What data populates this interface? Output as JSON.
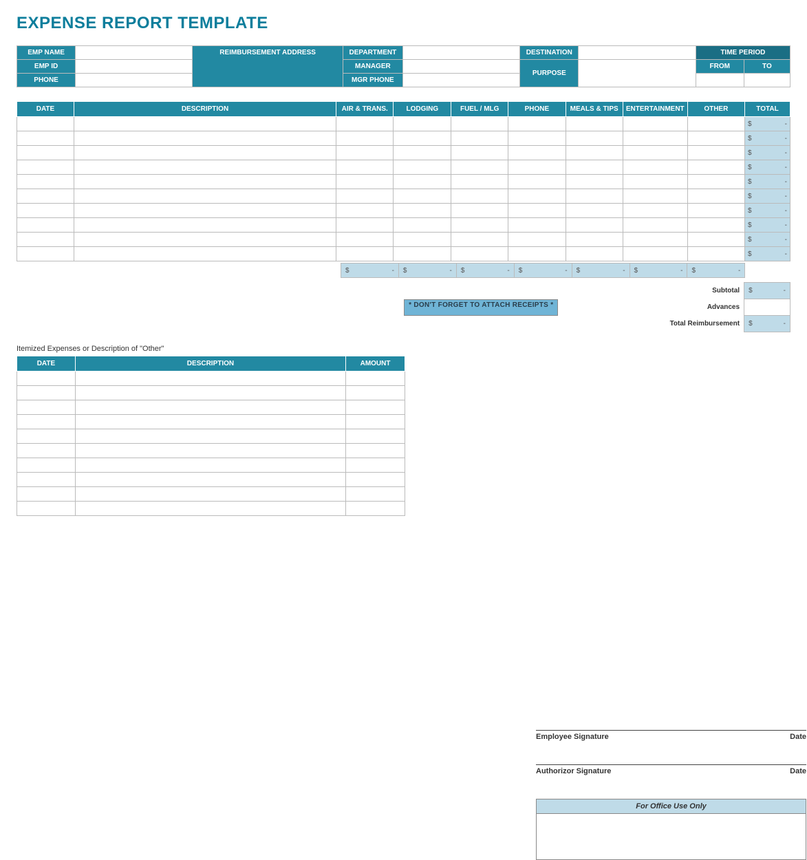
{
  "title": "EXPENSE REPORT TEMPLATE",
  "info": {
    "emp_name": "EMP NAME",
    "emp_id": "EMP ID",
    "phone": "PHONE",
    "reimbursement_address": "REIMBURSEMENT ADDRESS",
    "department": "DEPARTMENT",
    "manager": "MANAGER",
    "mgr_phone": "MGR PHONE",
    "destination": "DESTINATION",
    "purpose": "PURPOSE",
    "time_period": "TIME PERIOD",
    "from": "FROM",
    "to": "TO"
  },
  "main_headers": {
    "date": "DATE",
    "description": "DESCRIPTION",
    "air_trans": "AIR & TRANS.",
    "lodging": "LODGING",
    "fuel_mlg": "FUEL / MLG",
    "phone": "PHONE",
    "meals_tips": "MEALS & TIPS",
    "entertainment": "ENTERTAINMENT",
    "other": "OTHER",
    "total": "TOTAL"
  },
  "row_total_display": {
    "currency": "$",
    "dash": "-"
  },
  "col_sum_display": {
    "currency": "$",
    "dash": "-"
  },
  "summary": {
    "subtotal_label": "Subtotal",
    "subtotal_currency": "$",
    "subtotal_dash": "-",
    "advances_label": "Advances",
    "total_reimb_label": "Total Reimbursement",
    "total_reimb_currency": "$",
    "total_reimb_dash": "-",
    "receipts_note": "* DON'T FORGET TO ATTACH RECEIPTS *"
  },
  "itemized": {
    "caption": "Itemized Expenses or Description of \"Other\"",
    "headers": {
      "date": "DATE",
      "description": "DESCRIPTION",
      "amount": "AMOUNT"
    }
  },
  "sign": {
    "emp_sig": "Employee Signature",
    "auth_sig": "Authorizor Signature",
    "date": "Date"
  },
  "office": {
    "heading": "For Office Use Only"
  }
}
